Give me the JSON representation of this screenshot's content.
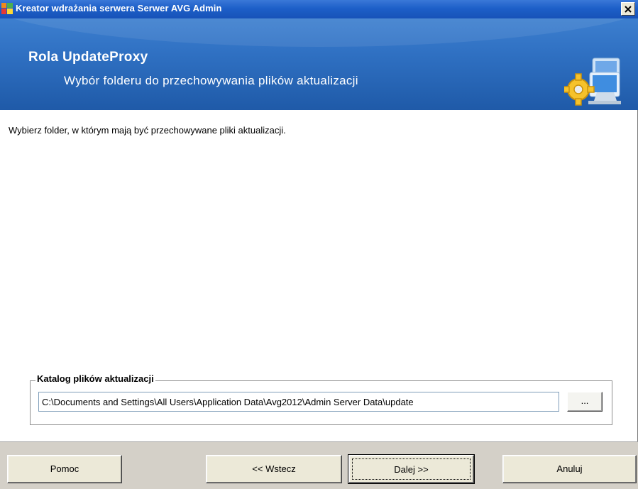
{
  "window": {
    "title": "Kreator wdrażania serwera Serwer AVG Admin",
    "close_glyph": "✕"
  },
  "banner": {
    "title": "Rola UpdateProxy",
    "subtitle": "Wybór folderu do przechowywania plików aktualizacji",
    "icon": "gear-computer-icon"
  },
  "content": {
    "intro": "Wybierz folder, w którym mają być przechowywane pliki aktualizacji."
  },
  "group": {
    "legend": "Katalog plików aktualizacji",
    "path_value": "C:\\Documents and Settings\\All Users\\Application Data\\Avg2012\\Admin Server Data\\update",
    "browse_label": "..."
  },
  "footer": {
    "help_label": "Pomoc",
    "back_label": "<< Wstecz",
    "next_label": "Dalej >>",
    "cancel_label": "Anuluj"
  },
  "colors": {
    "titlebar": "#1d5fc8",
    "banner": "#2f70c2",
    "footer": "#d4d0c8"
  }
}
